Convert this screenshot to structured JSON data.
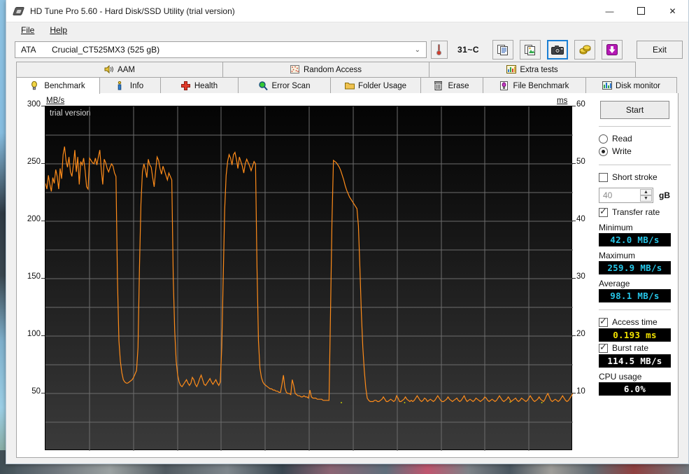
{
  "window": {
    "title": "HD Tune Pro 5.60 - Hard Disk/SSD Utility (trial version)",
    "icon": "hdd-icon",
    "minimize": "—",
    "maximize": "◻",
    "close": "✕"
  },
  "menu": [
    {
      "label": "File",
      "name": "menu-file"
    },
    {
      "label": "Help",
      "name": "menu-help"
    }
  ],
  "device_bar": {
    "bus": "ATA",
    "model": "Crucial_CT525MX3 (525 gB)",
    "dropdown_arrow": "⌄",
    "temperature": "31~C",
    "thermometer_icon": "thermometer-icon",
    "tools": [
      {
        "name": "copy-text-button",
        "icon": "copy-text-icon",
        "active": false
      },
      {
        "name": "copy-image-button",
        "icon": "copy-image-icon",
        "active": false
      },
      {
        "name": "screenshot-button",
        "icon": "camera-icon",
        "active": true
      },
      {
        "name": "options-button",
        "icon": "gold-coins-icon",
        "active": false
      },
      {
        "name": "save-button",
        "icon": "download-arrow-icon",
        "active": false
      }
    ],
    "exit_label": "Exit"
  },
  "tabs_row1": [
    {
      "label": "AAM",
      "icon": "speaker-icon",
      "name": "tab-aam"
    },
    {
      "label": "Random Access",
      "icon": "random-access-icon",
      "name": "tab-random-access"
    },
    {
      "label": "Extra tests",
      "icon": "extra-tests-icon",
      "name": "tab-extra-tests"
    }
  ],
  "tabs_row2": [
    {
      "label": "Benchmark",
      "icon": "bulb-icon",
      "name": "tab-benchmark",
      "selected": true
    },
    {
      "label": "Info",
      "icon": "info-icon",
      "name": "tab-info",
      "selected": false
    },
    {
      "label": "Health",
      "icon": "health-cross-icon",
      "name": "tab-health",
      "selected": false
    },
    {
      "label": "Error Scan",
      "icon": "magnifier-icon",
      "name": "tab-error-scan",
      "selected": false
    },
    {
      "label": "Folder Usage",
      "icon": "folder-icon",
      "name": "tab-folder-usage",
      "selected": false
    },
    {
      "label": "Erase",
      "icon": "trash-icon",
      "name": "tab-erase",
      "selected": false
    },
    {
      "label": "File Benchmark",
      "icon": "file-bulb-icon",
      "name": "tab-file-benchmark",
      "selected": false
    },
    {
      "label": "Disk monitor",
      "icon": "bar-chart-icon",
      "name": "tab-disk-monitor",
      "selected": false
    }
  ],
  "panel": {
    "start_label": "Start",
    "mode_read": "Read",
    "mode_write": "Write",
    "mode_selected": "Write",
    "short_stroke_label": "Short stroke",
    "short_stroke_checked": false,
    "short_stroke_value": "40",
    "short_stroke_unit": "gB",
    "transfer_rate_label": "Transfer rate",
    "transfer_rate_checked": true,
    "minimum_label": "Minimum",
    "minimum_value": "42.0 MB/s",
    "maximum_label": "Maximum",
    "maximum_value": "259.9 MB/s",
    "average_label": "Average",
    "average_value": "98.1 MB/s",
    "access_time_label": "Access time",
    "access_time_checked": true,
    "access_time_value": "0.193 ms",
    "burst_rate_label": "Burst rate",
    "burst_rate_checked": true,
    "burst_rate_value": "114.5 MB/s",
    "cpu_usage_label": "CPU usage",
    "cpu_usage_value": "6.0%"
  },
  "chart_data": {
    "type": "line",
    "title": "",
    "watermark": "trial version",
    "xlabel": "",
    "ylabel": "MB/s",
    "y2label": "ms",
    "ylim": [
      0,
      300
    ],
    "y2lim": [
      0,
      60
    ],
    "yticks": [
      300,
      250,
      200,
      150,
      100,
      50
    ],
    "y2ticks": [
      60,
      50,
      40,
      30,
      20,
      10
    ],
    "grid": true,
    "background": "#111111",
    "accent_color": "#ff8c1a",
    "access_dot_color": "#d8e000",
    "legend_position": "none",
    "series": [
      {
        "name": "Transfer rate",
        "color": "#ff8c1a",
        "unit": "MB/s",
        "values": [
          233,
          228,
          240,
          232,
          226,
          238,
          233,
          245,
          239,
          228,
          246,
          237,
          258,
          265,
          253,
          247,
          256,
          243,
          239,
          249,
          262,
          243,
          256,
          232,
          252,
          249,
          255,
          244,
          230,
          228,
          255,
          253,
          251,
          250,
          255,
          249,
          256,
          262,
          245,
          232,
          254,
          251,
          246,
          243,
          247,
          250,
          248,
          242,
          239,
          150,
          96,
          78,
          68,
          62,
          60,
          59,
          59,
          60,
          61,
          62,
          64,
          67,
          70,
          90,
          160,
          215,
          243,
          250,
          245,
          238,
          254,
          249,
          247,
          238,
          230,
          244,
          256,
          253,
          246,
          241,
          248,
          244,
          240,
          236,
          242,
          239,
          236,
          150,
          104,
          78,
          66,
          60,
          57,
          56,
          58,
          60,
          62,
          59,
          57,
          59,
          64,
          62,
          58,
          56,
          59,
          63,
          66,
          62,
          58,
          57,
          59,
          61,
          63,
          60,
          58,
          60,
          62,
          59,
          57,
          60,
          90,
          150,
          210,
          240,
          252,
          258,
          255,
          249,
          258,
          260,
          254,
          246,
          256,
          252,
          248,
          242,
          250,
          254,
          251,
          248,
          244,
          248,
          252,
          250,
          160,
          96,
          72,
          64,
          60,
          58,
          57,
          56,
          55,
          54,
          54,
          53,
          53,
          52,
          52,
          51,
          51,
          58,
          66,
          55,
          51,
          50,
          50,
          49,
          62,
          57,
          50,
          49,
          48,
          48,
          47,
          47,
          48,
          47,
          47,
          46,
          53,
          47,
          46,
          46,
          46,
          45,
          45,
          45,
          45,
          44,
          44,
          44,
          44,
          44,
          120,
          200,
          253,
          252,
          251,
          249,
          247,
          244,
          240,
          236,
          231,
          227,
          224,
          221,
          219,
          217,
          215,
          213,
          211,
          196,
          160,
          120,
          90,
          70,
          55,
          46,
          44,
          43,
          43,
          43,
          44,
          44,
          43,
          43,
          44,
          45,
          47,
          45,
          43,
          43,
          44,
          45,
          44,
          43,
          44,
          48,
          46,
          43,
          43,
          44,
          45,
          47,
          45,
          44,
          43,
          44,
          43,
          44,
          46,
          48,
          46,
          44,
          43,
          44,
          46,
          45,
          43,
          44,
          45,
          44,
          43,
          44,
          46,
          48,
          46,
          44,
          43,
          43,
          44,
          45,
          47,
          45,
          44,
          43,
          44,
          45,
          46,
          44,
          43,
          44,
          46,
          48,
          45,
          43,
          44,
          45,
          44,
          43,
          44,
          46,
          45,
          44,
          43,
          44,
          45,
          47,
          46,
          44,
          43,
          44,
          45,
          44,
          43,
          44,
          46,
          48,
          46,
          44,
          43,
          44,
          45,
          47,
          45,
          43,
          44,
          45,
          46,
          44,
          43,
          44,
          46,
          45,
          44,
          43,
          44,
          46,
          48,
          46,
          44,
          43,
          44,
          45,
          47,
          45,
          44,
          43,
          45,
          48,
          50,
          47,
          44,
          43,
          44,
          45,
          44,
          43,
          44,
          46,
          48,
          46,
          44,
          43,
          44,
          46,
          48,
          50
        ]
      },
      {
        "name": "Access time",
        "color": "#d8e000",
        "unit": "ms",
        "points": [
          {
            "x": 56,
            "y": 8.5
          },
          {
            "x": 68,
            "y": 8.5
          },
          {
            "x": 88,
            "y": 8.6
          },
          {
            "x": 94,
            "y": 8.5
          }
        ]
      }
    ]
  }
}
